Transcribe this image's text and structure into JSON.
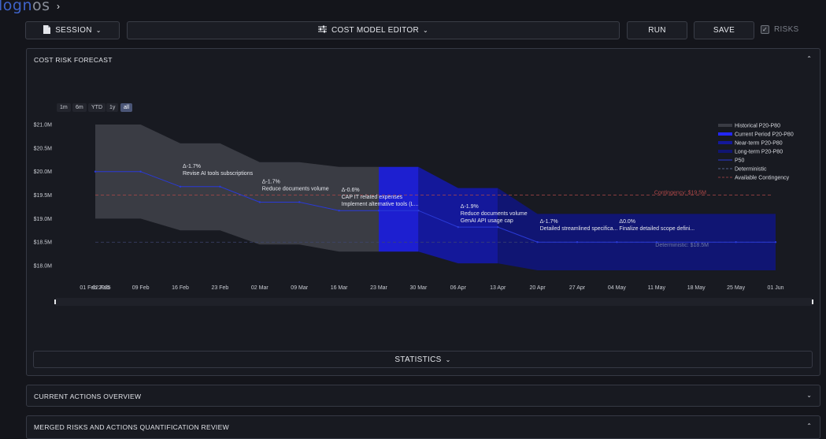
{
  "app": {
    "logo_main": "logn",
    "logo_dim": "os"
  },
  "toolbar": {
    "session_label": "SESSION",
    "editor_label": "COST MODEL EDITOR",
    "run_label": "RUN",
    "save_label": "SAVE",
    "risks_label": "RISKS",
    "risks_checked": true
  },
  "forecast_panel": {
    "title": "COST RISK FORECAST",
    "range_buttons": [
      "1m",
      "6m",
      "YTD",
      "1y",
      "all"
    ],
    "active_range": "all",
    "statistics_label": "STATISTICS"
  },
  "sections": [
    {
      "title": "CURRENT ACTIONS OVERVIEW"
    },
    {
      "title": "MERGED RISKS AND ACTIONS QUANTIFICATION REVIEW"
    }
  ],
  "colors": {
    "historical": "#3a3c44",
    "current": "#1d1fd0",
    "near_term": "#14189a",
    "long_term": "#101573",
    "p50": "#2a3ad8",
    "contingency": "#b04848",
    "deterministic": "#3d4570"
  },
  "chart_data": {
    "type": "area",
    "ylim": [
      17.8,
      21.0
    ],
    "y_ticks": [
      "$21.0M",
      "$20.5M",
      "$20.0M",
      "$19.5M",
      "$19.0M",
      "$18.5M",
      "$18.0M"
    ],
    "x_ticks": [
      "01 Feb 2025",
      "02 Feb",
      "09 Feb",
      "16 Feb",
      "23 Feb",
      "02 Mar",
      "09 Mar",
      "16 Mar",
      "23 Mar",
      "30 Mar",
      "06 Apr",
      "13 Apr",
      "20 Apr",
      "27 Apr",
      "04 May",
      "11 May",
      "18 May",
      "25 May",
      "01 Jun"
    ],
    "legend": [
      "Historical P20-P80",
      "Current Period P20-P80",
      "Near-term P20-P80",
      "Long-term P20-P80",
      "P50",
      "Deterministic",
      "Available Contingency"
    ],
    "legend_position": "top-right",
    "bands": [
      {
        "name": "Historical P20-P80",
        "x": [
          "2025-02-01",
          "2025-02-09",
          "2025-02-16",
          "2025-02-23",
          "2025-03-02",
          "2025-03-09",
          "2025-03-16",
          "2025-03-23"
        ],
        "upper": [
          21.0,
          21.0,
          20.6,
          20.6,
          20.2,
          20.2,
          20.1,
          20.1
        ],
        "lower": [
          19.0,
          19.0,
          18.75,
          18.75,
          18.45,
          18.45,
          18.3,
          18.3
        ]
      },
      {
        "name": "Current Period P20-P80",
        "x": [
          "2025-03-23",
          "2025-03-30"
        ],
        "upper": [
          20.1,
          20.1
        ],
        "lower": [
          18.3,
          18.3
        ]
      },
      {
        "name": "Near-term P20-P80",
        "x": [
          "2025-03-30",
          "2025-04-06",
          "2025-04-13"
        ],
        "upper": [
          20.1,
          19.65,
          19.65
        ],
        "lower": [
          18.3,
          18.05,
          18.05
        ]
      },
      {
        "name": "Long-term P20-P80",
        "x": [
          "2025-04-13",
          "2025-04-20",
          "2025-04-27",
          "2025-05-04",
          "2025-05-11",
          "2025-05-18",
          "2025-05-25",
          "2025-06-01"
        ],
        "upper": [
          19.65,
          19.1,
          19.1,
          19.1,
          19.1,
          19.1,
          19.1,
          19.1
        ],
        "lower": [
          18.05,
          17.9,
          17.9,
          17.9,
          17.9,
          17.9,
          17.9,
          17.9
        ]
      }
    ],
    "p50": {
      "x": [
        "2025-02-01",
        "2025-02-09",
        "2025-02-16",
        "2025-02-23",
        "2025-03-02",
        "2025-03-09",
        "2025-03-16",
        "2025-03-23",
        "2025-03-30",
        "2025-04-06",
        "2025-04-13",
        "2025-04-20",
        "2025-04-27",
        "2025-05-04",
        "2025-05-11",
        "2025-05-18",
        "2025-05-25",
        "2025-06-01"
      ],
      "y": [
        20.0,
        20.0,
        19.68,
        19.68,
        19.35,
        19.35,
        19.17,
        19.17,
        19.17,
        18.82,
        18.82,
        18.5,
        18.5,
        18.5,
        18.5,
        18.5,
        18.5,
        18.5
      ]
    },
    "contingency": {
      "value": 19.5,
      "label": "Contingency: $19.5M"
    },
    "deterministic": {
      "value": 18.5,
      "label": "Deterministic: $18.5M"
    },
    "annotations": [
      {
        "x": "2025-02-16",
        "y": 19.68,
        "delta": "Δ-1.7%",
        "lines": [
          "Revise AI tools subscriptions"
        ]
      },
      {
        "x": "2025-03-02",
        "y": 19.35,
        "delta": "Δ-1.7%",
        "lines": [
          "Reduce documents volume"
        ]
      },
      {
        "x": "2025-03-16",
        "y": 19.17,
        "delta": "Δ-0.6%",
        "lines": [
          "CAP IT related expenses",
          "Implement alternative tools (L..."
        ]
      },
      {
        "x": "2025-04-06",
        "y": 18.82,
        "delta": "Δ-1.9%",
        "lines": [
          "Reduce documents volume",
          "GenAI API usage cap"
        ]
      },
      {
        "x": "2025-04-20",
        "y": 18.5,
        "delta": "Δ-1.7%",
        "lines": [
          "Detailed streamlined specifica..."
        ]
      },
      {
        "x": "2025-05-04",
        "y": 18.5,
        "delta": "Δ0.0%",
        "lines": [
          "Finalize detailed scope defini..."
        ]
      }
    ]
  }
}
